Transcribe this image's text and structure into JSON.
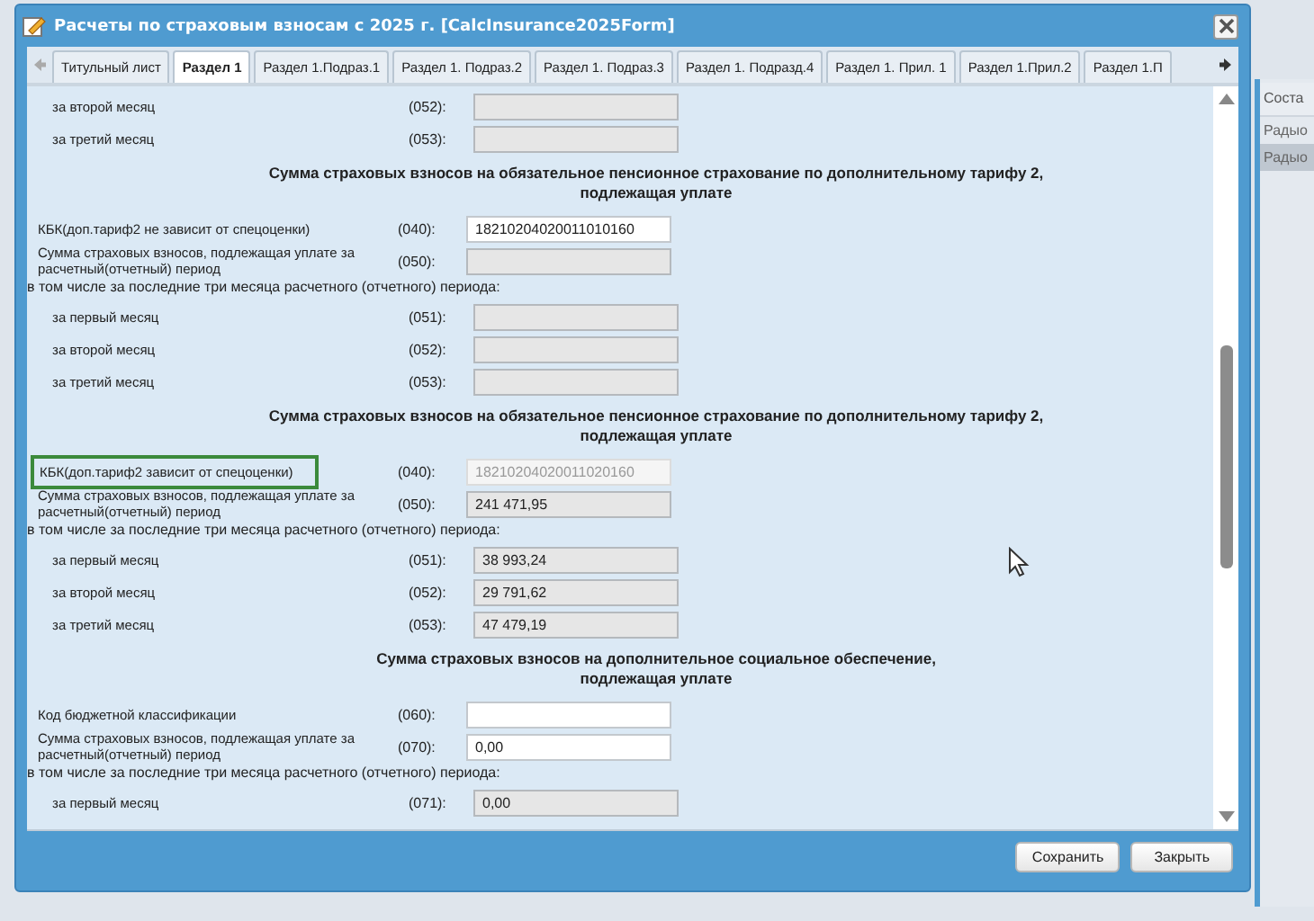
{
  "window": {
    "title": "Расчеты по страховым взносам с 2025 г. [CalcInsurance2025Form]"
  },
  "tabs": [
    {
      "label": "Титульный лист",
      "selected": false
    },
    {
      "label": "Раздел 1",
      "selected": true
    },
    {
      "label": "Раздел 1.Подраз.1",
      "selected": false
    },
    {
      "label": "Раздел 1. Подраз.2",
      "selected": false
    },
    {
      "label": "Раздел 1. Подраз.3",
      "selected": false
    },
    {
      "label": "Раздел 1. Подразд.4",
      "selected": false
    },
    {
      "label": "Раздел 1. Прил. 1",
      "selected": false
    },
    {
      "label": "Раздел 1.Прил.2",
      "selected": false
    },
    {
      "label": "Раздел 1.П",
      "selected": false
    }
  ],
  "sections": [
    {
      "rows": [
        {
          "kind": "sub",
          "label": "за второй месяц",
          "code": "(052):",
          "value": "",
          "readonly": true,
          "disabled": false,
          "focused": false
        },
        {
          "kind": "sub",
          "label": "за третий месяц",
          "code": "(053):",
          "value": "",
          "readonly": true,
          "disabled": false,
          "focused": false
        }
      ]
    },
    {
      "heading": [
        "Сумма страховых взносов на обязательное пенсионное страхование по дополнительному тарифу 2,",
        "подлежащая уплате"
      ],
      "rows": [
        {
          "kind": "field",
          "label": "КБК(доп.тариф2 не зависит от спецоценки)",
          "code": "(040):",
          "value": "18210204020011010160",
          "readonly": false,
          "disabled": false,
          "focused": false
        },
        {
          "kind": "field",
          "label": "Сумма страховых взносов, подлежащая уплате за расчетный(отчетный) период",
          "code": "(050):",
          "value": "",
          "readonly": true,
          "disabled": false,
          "focused": false
        },
        {
          "kind": "note",
          "label": "в том числе за последние три месяца расчетного (отчетного) периода:"
        },
        {
          "kind": "sub",
          "label": "за первый месяц",
          "code": "(051):",
          "value": "",
          "readonly": true,
          "disabled": false,
          "focused": false
        },
        {
          "kind": "sub",
          "label": "за второй месяц",
          "code": "(052):",
          "value": "",
          "readonly": true,
          "disabled": false,
          "focused": false
        },
        {
          "kind": "sub",
          "label": "за третий месяц",
          "code": "(053):",
          "value": "",
          "readonly": true,
          "disabled": false,
          "focused": false
        }
      ]
    },
    {
      "heading": [
        "Сумма страховых взносов на обязательное пенсионное страхование по дополнительному тарифу 2,",
        "подлежащая уплате"
      ],
      "rows": [
        {
          "kind": "field",
          "label": "КБК(доп.тариф2 зависит от спецоценки)",
          "code": "(040):",
          "value": "18210204020011020160",
          "readonly": true,
          "disabled": true,
          "focused": true
        },
        {
          "kind": "field",
          "label": "Сумма страховых взносов, подлежащая уплате за расчетный(отчетный) период",
          "code": "(050):",
          "value": "241 471,95",
          "readonly": true,
          "disabled": false,
          "focused": false
        },
        {
          "kind": "note",
          "label": "в том числе за последние три месяца расчетного (отчетного) периода:"
        },
        {
          "kind": "sub",
          "label": "за первый месяц",
          "code": "(051):",
          "value": "38 993,24",
          "readonly": true,
          "disabled": false,
          "focused": false
        },
        {
          "kind": "sub",
          "label": "за второй месяц",
          "code": "(052):",
          "value": "29 791,62",
          "readonly": true,
          "disabled": false,
          "focused": false
        },
        {
          "kind": "sub",
          "label": "за третий месяц",
          "code": "(053):",
          "value": "47 479,19",
          "readonly": true,
          "disabled": false,
          "focused": false
        }
      ]
    },
    {
      "heading": [
        "Сумма страховых взносов на дополнительное социальное обеспечение,",
        "подлежащая уплате"
      ],
      "rows": [
        {
          "kind": "field",
          "label": "Код бюджетной классификации",
          "code": "(060):",
          "value": "",
          "readonly": false,
          "disabled": false,
          "focused": false
        },
        {
          "kind": "field",
          "label": "Сумма страховых взносов, подлежащая уплате за расчетный(отчетный) период",
          "code": "(070):",
          "value": "0,00",
          "readonly": false,
          "disabled": false,
          "focused": false
        },
        {
          "kind": "note",
          "label": "в том числе за последние три месяца расчетного (отчетного) периода:"
        },
        {
          "kind": "sub",
          "label": "за первый месяц",
          "code": "(071):",
          "value": "0,00",
          "readonly": true,
          "disabled": false,
          "focused": false
        }
      ]
    }
  ],
  "buttons": [
    "Сохранить",
    "Закрыть"
  ],
  "background_table": {
    "header": "Соста",
    "rows": [
      {
        "text": "Радыо",
        "selected": false
      },
      {
        "text": "Радыо",
        "selected": true
      }
    ]
  }
}
